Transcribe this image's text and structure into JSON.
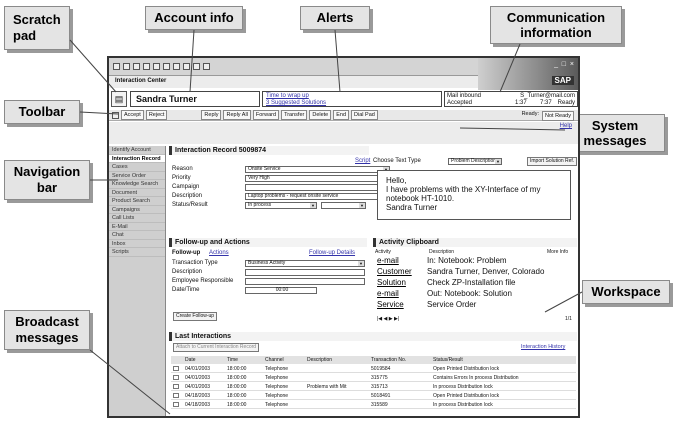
{
  "callouts": {
    "scratch_pad": "Scratch pad",
    "account_info": "Account info",
    "alerts": "Alerts",
    "communication_info": "Communication information",
    "toolbar": "Toolbar",
    "system_messages": "System messages",
    "navigation_bar": "Navigation bar",
    "workspace": "Workspace",
    "broadcast_messages": "Broadcast messages"
  },
  "app": {
    "title": "Interaction Center",
    "brand": "SAP",
    "account_name": "Sandra Turner",
    "alerts": [
      "Time to wrap up",
      "3 Suggested Solutions"
    ],
    "comm": {
      "channel": "Mail inbound",
      "email": "S_Turner@mail.com",
      "status": "Accepted",
      "t1": "1:37",
      "t2": "7:37",
      "state": "Ready"
    },
    "toolbar": {
      "buttons": [
        "Accept",
        "Reject",
        "Reply",
        "Reply All",
        "Forward",
        "Transfer",
        "Delete",
        "End",
        "Dial Pad"
      ],
      "ready_label": "Ready:",
      "ready_value": "Not Ready"
    },
    "help": "Help",
    "nav": [
      "Identify Account",
      "Interaction Record",
      "Cases",
      "Service Order",
      "Knowledge Search",
      "Document",
      "Product Search",
      "Campaigns",
      "Call Lists",
      "E-Mail",
      "Chat",
      "Inbox",
      "Scripts"
    ],
    "interaction_record": {
      "title": "Interaction Record 5009874",
      "script": "Script",
      "fields": [
        {
          "label": "Reason",
          "value": "Onsite Service"
        },
        {
          "label": "Priority",
          "value": "Very High"
        },
        {
          "label": "Campaign",
          "value": ""
        },
        {
          "label": "Description",
          "value": "Laptop problems - request onsite service"
        },
        {
          "label": "Status/Result",
          "value": "In process"
        }
      ]
    },
    "text_type": {
      "label": "Choose Text Type",
      "value": "Problem Description",
      "import_button": "Import Solution Ref."
    },
    "email_text": [
      "Hello,",
      "I have problems with the XY-Interface of my",
      "notebook HT-1010.",
      "Sandra Turner"
    ],
    "followup": {
      "title": "Follow-up and Actions",
      "tab1": "Follow-up",
      "tab2": "Actions",
      "details": "Follow-up Details",
      "fields": [
        {
          "label": "Transaction Type",
          "value": "Business Activity"
        },
        {
          "label": "Description",
          "value": ""
        },
        {
          "label": "Employee Responsible",
          "value": ""
        },
        {
          "label": "Date/Time",
          "value": "00:00"
        }
      ],
      "create_button": "Create Follow-up"
    },
    "clipboard": {
      "title": "Activity Clipboard",
      "headers": [
        "Activity",
        "Description",
        "More Info"
      ],
      "rows": [
        {
          "k": "e-mail",
          "v": "In: Notebook: Problem"
        },
        {
          "k": "Customer",
          "v": "Sandra Turner, Denver, Colorado"
        },
        {
          "k": "Solution",
          "v": "Check ZP-Installation file"
        },
        {
          "k": "e-mail",
          "v": "Out: Notebook: Solution"
        },
        {
          "k": "Service",
          "v": "Service Order"
        }
      ],
      "page": "1/1"
    },
    "last_interactions": {
      "title": "Last Interactions",
      "attach_button": "Attach to Current Interaction Record",
      "history": "Interaction History",
      "headers": [
        "Date",
        "Time",
        "Channel",
        "Description",
        "Transaction No.",
        "Status/Result"
      ],
      "rows": [
        [
          "04/01/2003",
          "18:00:00",
          "Telephone",
          "",
          "5019584",
          "Open Printed Distribution lock"
        ],
        [
          "04/01/2003",
          "18:00:00",
          "Telephone",
          "",
          "315775",
          "Contains Errors In process Distribution"
        ],
        [
          "04/01/2003",
          "18:00:00",
          "Telephone",
          "Problems with Mit",
          "315713",
          "In process Distribution lock"
        ],
        [
          "04/18/2003",
          "18:00:00",
          "Telephone",
          "",
          "5018491",
          "Open Printed Distribution lock"
        ],
        [
          "04/18/2003",
          "18:00:00",
          "Telephone",
          "",
          "315589",
          "In process Distribution lock"
        ]
      ]
    }
  }
}
